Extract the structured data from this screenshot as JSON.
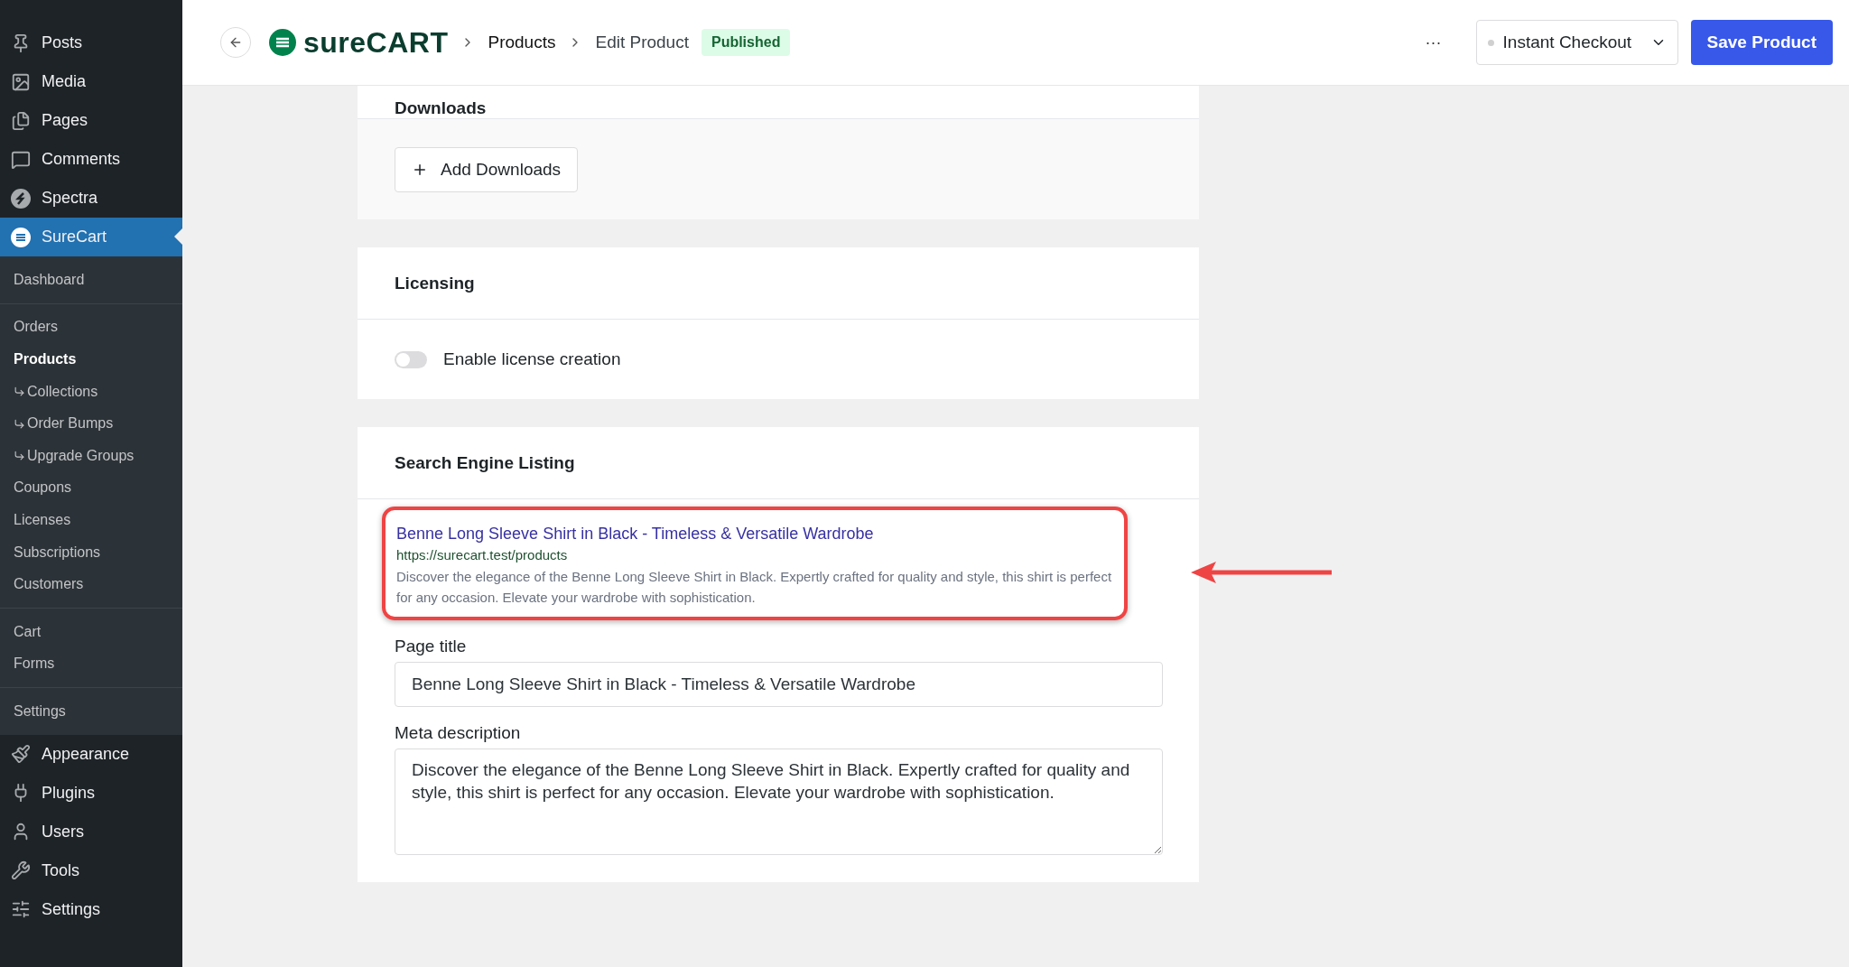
{
  "sidebar": {
    "items": [
      {
        "label": "Posts",
        "selected": false
      },
      {
        "label": "Media",
        "selected": false
      },
      {
        "label": "Pages",
        "selected": false
      },
      {
        "label": "Comments",
        "selected": false
      },
      {
        "label": "Spectra",
        "selected": false
      },
      {
        "label": "SureCart",
        "selected": true,
        "submenu": [
          [
            {
              "label": "Dashboard",
              "kind": "item",
              "selected": false
            }
          ],
          [
            {
              "label": "Orders",
              "kind": "item",
              "selected": false
            },
            {
              "label": "Products",
              "kind": "item",
              "selected": true
            },
            {
              "label": "Collections",
              "kind": "subitem",
              "selected": false
            },
            {
              "label": "Order Bumps",
              "kind": "subitem",
              "selected": false
            },
            {
              "label": "Upgrade Groups",
              "kind": "subitem",
              "selected": false
            },
            {
              "label": "Coupons",
              "kind": "item",
              "selected": false
            },
            {
              "label": "Licenses",
              "kind": "item",
              "selected": false
            },
            {
              "label": "Subscriptions",
              "kind": "item",
              "selected": false
            },
            {
              "label": "Customers",
              "kind": "item",
              "selected": false
            }
          ],
          [
            {
              "label": "Cart",
              "kind": "item",
              "selected": false
            },
            {
              "label": "Forms",
              "kind": "item",
              "selected": false
            }
          ],
          [
            {
              "label": "Settings",
              "kind": "item",
              "selected": false
            }
          ]
        ]
      },
      {
        "label": "Appearance",
        "selected": false
      },
      {
        "label": "Plugins",
        "selected": false
      },
      {
        "label": "Users",
        "selected": false
      },
      {
        "label": "Tools",
        "selected": false
      },
      {
        "label": "Settings",
        "selected": false
      }
    ]
  },
  "header": {
    "logo": "sureCART",
    "breadcrumbs": [
      "Products",
      "Edit Product"
    ],
    "status": "Published",
    "more": "···",
    "checkout_select": "Instant Checkout",
    "save_button": "Save Product"
  },
  "downloads": {
    "title": "Downloads",
    "add_button": "Add Downloads"
  },
  "licensing": {
    "title": "Licensing",
    "toggle": {
      "label": "Enable license creation",
      "on": false
    }
  },
  "seo": {
    "title": "Search Engine Listing",
    "preview": {
      "title": "Benne Long Sleeve Shirt in Black - Timeless & Versatile Wardrobe",
      "url": "https://surecart.test/products",
      "description": "Discover the elegance of the Benne Long Sleeve Shirt in Black. Expertly crafted for quality and style, this shirt is perfect for any occasion. Elevate your wardrobe with sophistication."
    },
    "page_title": {
      "label": "Page title",
      "value": "Benne Long Sleeve Shirt in Black - Timeless & Versatile Wardrobe"
    },
    "meta_description": {
      "label": "Meta description",
      "value": "Discover the elegance of the Benne Long Sleeve Shirt in Black. Expertly crafted for quality and style, this shirt is perfect for any occasion. Elevate your wardrobe with sophistication."
    }
  }
}
